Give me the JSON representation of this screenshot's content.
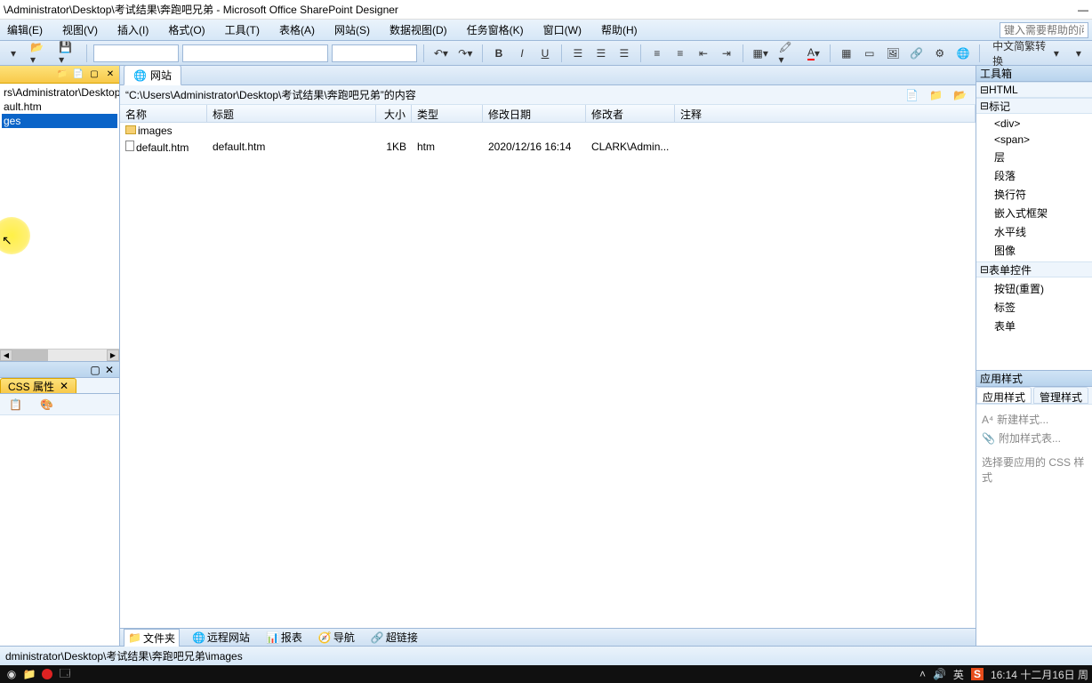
{
  "title": "\\Administrator\\Desktop\\考试结果\\奔跑吧兄弟 - Microsoft Office SharePoint Designer",
  "menus": [
    "编辑(E)",
    "视图(V)",
    "插入(I)",
    "格式(O)",
    "工具(T)",
    "表格(A)",
    "网站(S)",
    "数据视图(D)",
    "任务窗格(K)",
    "窗口(W)",
    "帮助(H)"
  ],
  "help_placeholder": "键入需要帮助的问题",
  "cn_convert": "中文简繁转换",
  "left": {
    "path_line": "rs\\Administrator\\Desktop",
    "file_line": "ault.htm",
    "selected": "ges"
  },
  "css_tab": "CSS 属性",
  "doc_tab": "网站",
  "content_path": "“C:\\Users\\Administrator\\Desktop\\考试结果\\奔跑吧兄弟”的内容",
  "columns": {
    "name": "名称",
    "title": "标题",
    "size": "大小",
    "type": "类型",
    "date": "修改日期",
    "modby": "修改者",
    "comment": "注释"
  },
  "rows": [
    {
      "icon": "folder",
      "name": "images",
      "title": "",
      "size": "",
      "type": "",
      "date": "",
      "modby": "",
      "comment": ""
    },
    {
      "icon": "file",
      "name": "default.htm",
      "title": "default.htm",
      "size": "1KB",
      "type": "htm",
      "date": "2020/12/16 16:14",
      "modby": "CLARK\\Admin...",
      "comment": ""
    }
  ],
  "bottom_tabs": [
    "文件夹",
    "远程网站",
    "报表",
    "导航",
    "超链接"
  ],
  "toolbox_title": "工具箱",
  "html_group": "HTML",
  "markup_group": "标记",
  "markup_items": [
    "<div>",
    "<span>",
    "层",
    "段落",
    "换行符",
    "嵌入式框架",
    "水平线",
    "图像"
  ],
  "form_group": "表单控件",
  "form_items": [
    "按钮(重置)",
    "标签",
    "表单"
  ],
  "styles_title": "应用样式",
  "styles_tabs": [
    "应用样式",
    "管理样式"
  ],
  "new_style": "新建样式...",
  "attach_style": "附加样式表...",
  "css_hint": "选择要应用的 CSS 样式",
  "statusbar_path": "dministrator\\Desktop\\考试结果\\奔跑吧兄弟\\images",
  "taskbar": {
    "ime": "英",
    "time": "16:14 十二月16日 周"
  }
}
